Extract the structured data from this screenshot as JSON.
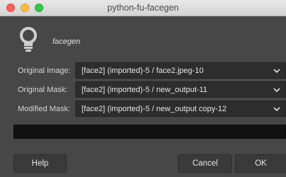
{
  "window": {
    "title": "python-fu-facegen"
  },
  "plugin": {
    "name": "facegen",
    "icon": "lightbulb-icon"
  },
  "fields": [
    {
      "label": "Original Image:",
      "value": "[face2] (imported)-5 / face2.jpeg-10"
    },
    {
      "label": "Original Mask:",
      "value": "[face2] (imported)-5 / new_output-11"
    },
    {
      "label": "Modified Mask:",
      "value": "[face2] (imported)-5 / new_output copy-12"
    }
  ],
  "buttons": {
    "help": "Help",
    "cancel": "Cancel",
    "ok": "OK"
  },
  "colors": {
    "background": "#474747",
    "combo_bg": "#2d2d2d",
    "progress_bg": "#121212"
  }
}
